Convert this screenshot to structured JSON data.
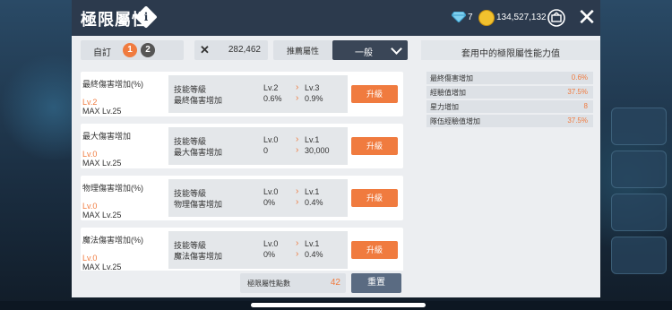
{
  "header": {
    "title": "極限屬性",
    "gem_count": "7",
    "gold_count": "134,527,132"
  },
  "preset": {
    "label": "自訂",
    "options": [
      "1",
      "2"
    ],
    "cost": "282,462",
    "recommend_label": "推薦屬性",
    "recommend_value": "一般"
  },
  "attributes": [
    {
      "name": "最終傷害增加(%)",
      "level": "Lv.2",
      "max": "MAX Lv.25",
      "row1_label": "技能等級",
      "row2_label": "最終傷害增加",
      "row1_cur": "Lv.2",
      "row2_cur": "0.6%",
      "row1_next": "Lv.3",
      "row2_next": "0.9%",
      "button": "升級"
    },
    {
      "name": "最大傷害增加",
      "level": "Lv.0",
      "max": "MAX Lv.25",
      "row1_label": "技能等級",
      "row2_label": "最大傷害增加",
      "row1_cur": "Lv.0",
      "row2_cur": "0",
      "row1_next": "Lv.1",
      "row2_next": "30,000",
      "button": "升級"
    },
    {
      "name": "物理傷害增加(%)",
      "level": "Lv.0",
      "max": "MAX Lv.25",
      "row1_label": "技能等級",
      "row2_label": "物理傷害增加",
      "row1_cur": "Lv.0",
      "row2_cur": "0%",
      "row1_next": "Lv.1",
      "row2_next": "0.4%",
      "button": "升級"
    },
    {
      "name": "魔法傷害增加(%)",
      "level": "Lv.0",
      "max": "MAX Lv.25",
      "row1_label": "技能等級",
      "row2_label": "魔法傷害增加",
      "row1_cur": "Lv.0",
      "row2_cur": "0%",
      "row1_next": "Lv.1",
      "row2_next": "0.4%",
      "button": "升級"
    }
  ],
  "footer": {
    "points_label": "極限屬性點數",
    "points_value": "42",
    "reset_label": "重置"
  },
  "summary": {
    "title": "套用中的極限屬性能力值",
    "rows": [
      {
        "name": "最終傷害增加",
        "value": "0.6%"
      },
      {
        "name": "經驗值增加",
        "value": "37.5%"
      },
      {
        "name": "星力增加",
        "value": "8"
      },
      {
        "name": "隊伍經驗值增加",
        "value": "37.5%"
      }
    ]
  },
  "colors": {
    "accent": "#f07b3f",
    "header_bg": "#2c3a4d"
  },
  "icons": [
    "info-icon",
    "gem-icon",
    "gold-coin-icon",
    "shop-icon",
    "close-icon",
    "chevron-down-icon",
    "arrow-right-icon"
  ]
}
